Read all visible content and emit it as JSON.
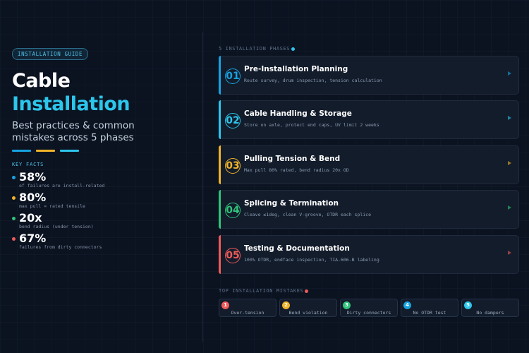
{
  "guide_badge": "INSTALLATION GUIDE",
  "title": {
    "line1": "Cable",
    "line2": "Installation",
    "subtitle": "Best practices & common mistakes across 5 phases"
  },
  "colors": {
    "cyan": "#2cc6ec",
    "blue": "#16a3e0",
    "amber": "#f0b429",
    "green": "#2ec47a",
    "red": "#ef5a5a"
  },
  "key_facts": {
    "label": "KEY FACTS",
    "items": [
      {
        "value": "58%",
        "desc": "of failures are install-related",
        "color": "#16a3e0"
      },
      {
        "value": "80%",
        "desc": "max pull = rated tensile",
        "color": "#f0b429"
      },
      {
        "value": "20x",
        "desc": "bend radius (under tension)",
        "color": "#2ec47a"
      },
      {
        "value": "67%",
        "desc": "failures from dirty connectors",
        "color": "#ef5a5a"
      }
    ]
  },
  "phases": {
    "label": "5 INSTALLATION PHASES",
    "items": [
      {
        "num": "01",
        "title": "Pre-Installation Planning",
        "desc": "Route survey, drum inspection, tension calculation",
        "color": "#16a3e0"
      },
      {
        "num": "02",
        "title": "Cable Handling & Storage",
        "desc": "Store on axle, protect end caps, UV limit 2 weeks",
        "color": "#2cc6ec"
      },
      {
        "num": "03",
        "title": "Pulling Tension & Bend",
        "desc": "Max pull 80% rated, bend radius 20x OD",
        "color": "#f0b429"
      },
      {
        "num": "04",
        "title": "Splicing & Termination",
        "desc": "Cleave ≤1deg, clean V-groove, OTDR each splice",
        "color": "#2ec47a"
      },
      {
        "num": "05",
        "title": "Testing & Documentation",
        "desc": "100% OTDR, endface inspection, TIA-606-B labeling",
        "color": "#ef5a5a"
      }
    ]
  },
  "mistakes": {
    "label": "TOP INSTALLATION MISTAKES",
    "items": [
      {
        "num": "1",
        "label": "Over-tension",
        "color": "#ef5a5a"
      },
      {
        "num": "2",
        "label": "Bend violation",
        "color": "#f0b429"
      },
      {
        "num": "3",
        "label": "Dirty connectors",
        "color": "#2ec47a"
      },
      {
        "num": "4",
        "label": "No OTDR test",
        "color": "#16a3e0"
      },
      {
        "num": "5",
        "label": "No dampers",
        "color": "#2cc6ec"
      }
    ]
  }
}
